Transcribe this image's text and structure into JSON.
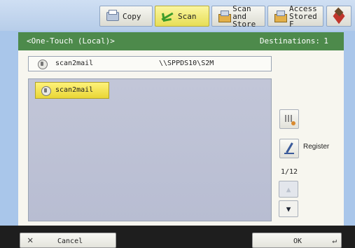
{
  "tabs": [
    {
      "label": "Copy",
      "icon": "copy-icon",
      "active": false
    },
    {
      "label": "Scan",
      "icon": "scan-checkmark-icon",
      "active": true
    },
    {
      "label": "Scan and\nStore",
      "icon": "scan-store-icon",
      "active": false
    },
    {
      "label": "Access\nStored F",
      "icon": "access-stored-icon",
      "active": false
    }
  ],
  "header": {
    "title": "<One-Touch (Local)>",
    "destinations_label": "Destinations:",
    "destinations_count": "1"
  },
  "selected_destination": {
    "name": "scan2mail",
    "path": "\\\\SPPDS10\\S2M",
    "icon": "shield-icon"
  },
  "list": {
    "items": [
      {
        "name": "scan2mail",
        "selected": true,
        "icon": "shield-icon"
      }
    ]
  },
  "side": {
    "find_icon": "address-book-icon",
    "register_icon": "pen-icon",
    "register_label": "Register",
    "page_indicator": "1/12"
  },
  "footer": {
    "cancel_label": "Cancel",
    "ok_label": "OK"
  },
  "colors": {
    "header_green": "#4d8a4b",
    "selected_yellow": "#f3e552",
    "list_bg": "#bcc1d5"
  }
}
